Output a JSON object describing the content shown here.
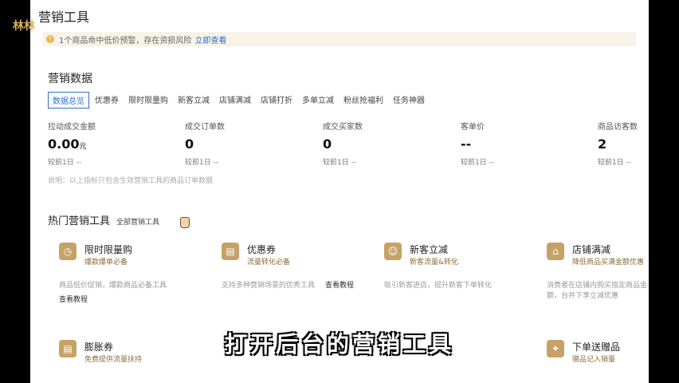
{
  "watermark": "林林",
  "page_title": "营销工具",
  "notice": {
    "icon": "warning-icon",
    "text": "1个商品命中低价预警，存在资损风险",
    "link": "立即查看"
  },
  "marketing_data": {
    "title": "营销数据",
    "tabs": [
      "数据总览",
      "优惠券",
      "限时限量购",
      "新客立减",
      "店铺满减",
      "店铺打折",
      "多单立减",
      "粉丝抢福利",
      "任务神器"
    ],
    "metrics": [
      {
        "label": "拉动成交金额",
        "value": "0.00",
        "unit": "元",
        "compare": "较前1日 --"
      },
      {
        "label": "成交订单数",
        "value": "0",
        "unit": "",
        "compare": "较前1日 --"
      },
      {
        "label": "成交买家数",
        "value": "0",
        "unit": "",
        "compare": "较前1日 --"
      },
      {
        "label": "客单价",
        "value": "--",
        "unit": "",
        "compare": "较前1日 --"
      },
      {
        "label": "商品访客数",
        "value": "2",
        "unit": "",
        "compare": "较前1日 --"
      }
    ],
    "note": "说明：以上指标只包含生效营销工具的商品订单数据"
  },
  "hot_tools": {
    "title": "热门营销工具",
    "all_link": "全部营销工具",
    "tools": [
      {
        "name": "限时限量购",
        "tag": "爆款爆单必备",
        "desc": "商品低价促销，爆款商品必备工具",
        "tutorial": "查看教程",
        "icon": "clock-icon"
      },
      {
        "name": "优惠券",
        "tag": "流量转化必备",
        "desc": "支持多种营销场景的优秀工具",
        "tutorial": "查看教程",
        "icon": "coupon-icon"
      },
      {
        "name": "新客立减",
        "tag": "新客流量&转化",
        "desc": "吸引新客进店，提升新客下单转化",
        "tutorial": "",
        "icon": "new-user-icon"
      },
      {
        "name": "店铺满减",
        "tag": "降低商品买满金额优惠",
        "desc": "消费者在店铺内购买指定商品金额，台并下享立减优惠",
        "tutorial": "",
        "icon": "store-icon"
      },
      {
        "name": "膨胀券",
        "tag": "免费提供流量扶持",
        "desc": "",
        "tutorial": "",
        "icon": "coupon-icon"
      },
      {
        "name": "下单送赠品",
        "tag": "赠品记入销量",
        "desc": "",
        "tutorial": "",
        "icon": "gift-icon"
      }
    ]
  },
  "subtitle": "打开后台的营销工具"
}
